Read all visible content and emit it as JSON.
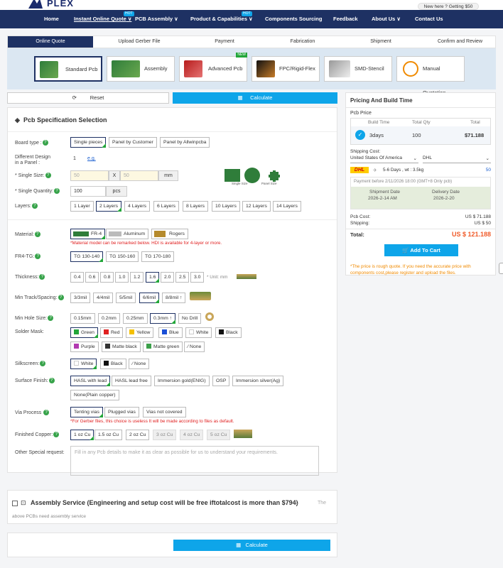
{
  "brand": {
    "name": "PLEX"
  },
  "coupon": "New here ? Getting $50 coupon",
  "nav": [
    {
      "label": "Home"
    },
    {
      "label": "Instant Online Quote",
      "hot": "HOT"
    },
    {
      "label": "PCB Assembly"
    },
    {
      "label": "Product & Capabilities",
      "hot": "HOT"
    },
    {
      "label": "Components Sourcing"
    },
    {
      "label": "Feedback"
    },
    {
      "label": "About Us"
    },
    {
      "label": "Contact Us"
    }
  ],
  "steps": [
    "Online Quote",
    "Upload Gerber File",
    "Payment",
    "Fabrication",
    "Shipment",
    "Confirm and Review"
  ],
  "types": [
    {
      "label": "Standard Pcb"
    },
    {
      "label": "Assembly"
    },
    {
      "label": "Advanced Pcb",
      "badge": "NEW"
    },
    {
      "label": "FPC/Rigid-Flex"
    },
    {
      "label": "SMD-Stencil"
    },
    {
      "label": "Manual Quotation"
    }
  ],
  "actions": {
    "reset": "Reset",
    "calculate": "Calculate"
  },
  "spec": {
    "title": "Pcb Specification Selection",
    "board_type": {
      "label": "Board type :",
      "options": [
        "Single pieces",
        "Panel by Customer",
        "Panel by Allwinpcba"
      ]
    },
    "diff_design": {
      "label1": "Different Design",
      "label2": "in a Panel :",
      "value": "1",
      "link": "e.g."
    },
    "single_size": {
      "label": "* Single Size:",
      "w": "50",
      "x": "X",
      "h": "50",
      "unit": "mm",
      "cap1": "Single Size",
      "cap2": "Panel Size"
    },
    "quantity": {
      "label": "* Single Quantity:",
      "value": "100",
      "unit": "pcs"
    },
    "layers": {
      "label": "Layers:",
      "options": [
        "1 Layer",
        "2 Layers",
        "4 Layers",
        "6 Layers",
        "8 Layers",
        "10 Layers",
        "12 Layers",
        "14 Layers"
      ]
    },
    "material": {
      "label": "Material:",
      "options": [
        "FR-4",
        "Aluminum",
        "Rogers"
      ],
      "note": "*Material model can be remarked below. HDI is available for 4-layer or more."
    },
    "tg": {
      "label": "FR4-TG:",
      "options": [
        "TG 130-140",
        "TG 150-160",
        "TG 170-180"
      ]
    },
    "thickness": {
      "label": "Thickness:",
      "options": [
        "0.4",
        "0.6",
        "0.8",
        "1.0",
        "1.2",
        "1.6",
        "2.0",
        "2.5",
        "3.0"
      ],
      "unit": "* Unit: mm"
    },
    "track": {
      "label": "Min Track/Spacing:",
      "options": [
        "3/3mil",
        "4/4mil",
        "5/5mil",
        "6/6mil",
        "8/8mil ↑"
      ]
    },
    "hole": {
      "label": "Min Hole Size:",
      "options": [
        "0.15mm",
        "0.2mm",
        "0.25mm",
        "0.3mm ↑",
        "No Drill"
      ]
    },
    "mask": {
      "label": "Solder Mask:",
      "options": [
        "Green",
        "Red",
        "Yellow",
        "Blue",
        "White",
        "Black",
        "Purple",
        "Matte black",
        "Matte green",
        "None"
      ]
    },
    "silk": {
      "label": "Silkscreen:",
      "options": [
        "White",
        "Black",
        "None"
      ]
    },
    "finish": {
      "label": "Surface Finish:",
      "options": [
        "HASL with lead",
        "HASL lead free",
        "Immersion gold(ENIG)",
        "OSP",
        "Immersion silver(Ag)",
        "None(Plain copper)"
      ]
    },
    "via": {
      "label": "Via Process",
      "options": [
        "Tenting vias",
        "Plugged vias",
        "Vias not covered"
      ],
      "note": "*For Gerber files, this choice is useless It will be made according to files as default."
    },
    "copper": {
      "label": "Finished Copper:",
      "options": [
        "1 oz Cu",
        "1.5 oz Cu",
        "2 oz Cu",
        "3 oz Cu",
        "4 oz Cu",
        "5 oz Cu"
      ]
    },
    "other": {
      "label": "Other Special request:",
      "placeholder": "Fill in any Pcb details to make it as clear as possible for us to understand your requirements."
    }
  },
  "pricing": {
    "title": "Pricing And Build Time",
    "pcb_price": "Pcb Price",
    "cols": [
      "Build Time",
      "Total Qty",
      "Total"
    ],
    "row": {
      "time": "3days",
      "qty": "100",
      "total": "$71.188"
    },
    "ship_label": "Shipping Cost:",
    "country": "United States Of America",
    "carrier": "DHL",
    "ship_info": "5-6 Days , wt : 3.5kg",
    "ship_price": "50",
    "pay_before": "Payment before 2/11/2026 18:00 (GMT+8 Only pcb)",
    "ship_date_label": "Shipment Date",
    "ship_date": "2026-2-14 AM",
    "delivery_label": "Delivery Date",
    "delivery_date": "2026-2-20",
    "pcb_cost_label": "Pcb Cost:",
    "pcb_cost": "US $ 71.188",
    "shipping_label": "Shipping:",
    "shipping": "US $ 50",
    "total_label": "Total:",
    "total": "US $ 121.188",
    "cart": "Add To Cart",
    "note": "*The price is rough quote. If you need the accurate price with components cost,please register and upload the files."
  },
  "assembly": {
    "title": "Assembly Service  (Engineering and setup cost will be free iftotalcost is more than $794)",
    "tail": "The",
    "sub": "above PCBs need assembly service"
  },
  "colors": {
    "navy": "#1e3163",
    "accent": "#0ea5e9",
    "green": "#22a63a",
    "red": "#e02020",
    "orange": "#f08a00"
  }
}
